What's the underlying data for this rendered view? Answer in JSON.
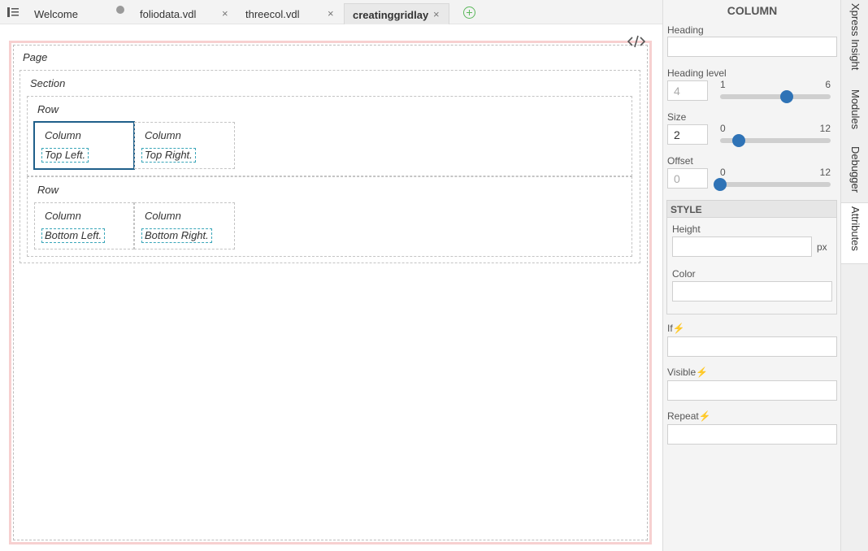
{
  "tabs": [
    {
      "label": "Welcome"
    },
    {
      "label": "foliodata.vdl"
    },
    {
      "label": "threecol.vdl"
    },
    {
      "label": "creatinggridlayo"
    }
  ],
  "tab_close_glyph": "×",
  "canvas": {
    "page_label": "Page",
    "section_label": "Section",
    "rows": [
      {
        "label": "Row",
        "columns": [
          {
            "label": "Column",
            "text": "Top Left."
          },
          {
            "label": "Column",
            "text": "Top Right."
          }
        ]
      },
      {
        "label": "Row",
        "columns": [
          {
            "label": "Column",
            "text": "Bottom Left."
          },
          {
            "label": "Column",
            "text": "Bottom Right."
          }
        ]
      }
    ]
  },
  "panel": {
    "title": "COLUMN",
    "heading_label": "Heading",
    "heading_value": "",
    "heading_level": {
      "label": "Heading level",
      "value": "4",
      "min": "1",
      "max": "6",
      "fraction": 0.6
    },
    "size": {
      "label": "Size",
      "value": "2",
      "min": "0",
      "max": "12",
      "fraction": 0.1667
    },
    "offset": {
      "label": "Offset",
      "value": "0",
      "min": "0",
      "max": "12",
      "fraction": 0
    },
    "style_header": "STYLE",
    "height_label": "Height",
    "height_unit": "px",
    "color_label": "Color",
    "if_label": "If",
    "visible_label": "Visible",
    "repeat_label": "Repeat",
    "bolt_glyph": "⚡"
  },
  "side_tabs": [
    {
      "label": "Xpress Insight"
    },
    {
      "label": "Modules"
    },
    {
      "label": "Debugger"
    },
    {
      "label": "Attributes"
    }
  ],
  "colors": {
    "accent": "#2f73b6",
    "selected_border": "#1f5f8a",
    "page_border": "#f7d0d0",
    "text_chip_border": "#3aa6b9"
  }
}
